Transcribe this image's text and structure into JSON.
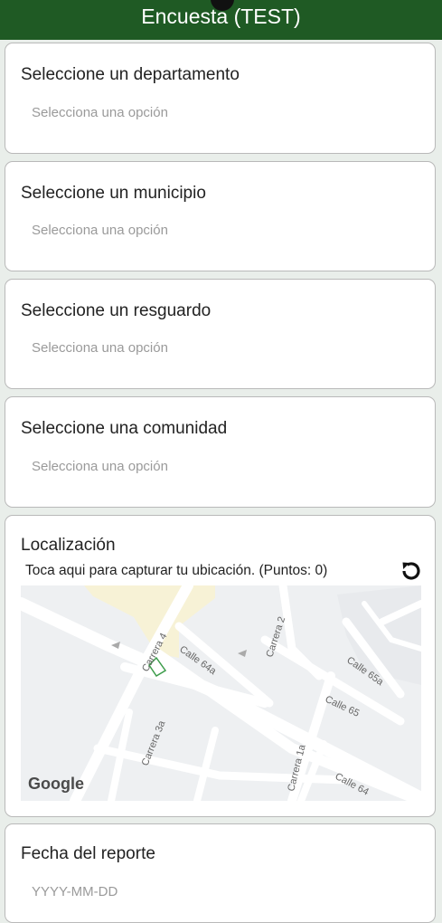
{
  "app": {
    "title": "Encuesta (TEST)"
  },
  "fields": [
    {
      "label": "Seleccione un departamento",
      "placeholder": "Selecciona una opción"
    },
    {
      "label": "Seleccione un municipio",
      "placeholder": "Selecciona una opción"
    },
    {
      "label": "Seleccione un resguardo",
      "placeholder": "Selecciona una opción"
    },
    {
      "label": "Seleccione una comunidad",
      "placeholder": "Selecciona una opción"
    }
  ],
  "location": {
    "label": "Localización",
    "hint": "Toca aqui para capturar tu ubicación. (Puntos: 0)",
    "reset_icon": "refresh-icon",
    "map": {
      "streets": {
        "carrera_4": "Carrera 4",
        "calle_64a": "Calle 64a",
        "carrera_2": "Carrera 2",
        "calle_65a": "Calle 65a",
        "calle_65": "Calle 65",
        "carrera_3a": "Carrera 3a",
        "carrera_1a": "Carrera 1a",
        "calle_64": "Calle 64"
      },
      "logo": "Google"
    }
  },
  "date": {
    "label": "Fecha del reporte",
    "placeholder": "YYYY-MM-DD"
  },
  "colors": {
    "appbar": "#1f5a24",
    "background": "#e9eeea",
    "card_border": "#b9b9b9"
  }
}
